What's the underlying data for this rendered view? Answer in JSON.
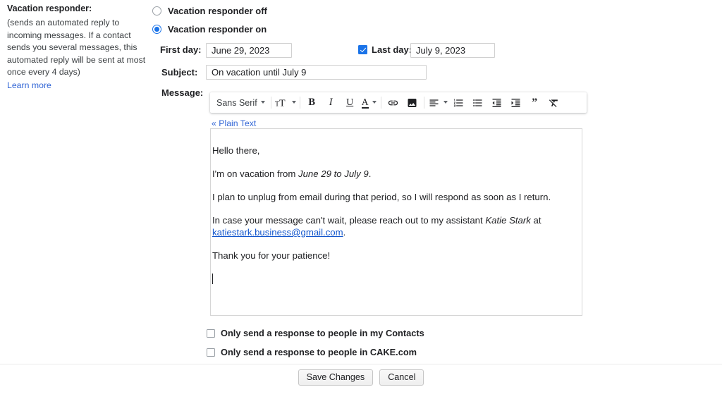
{
  "sidebar": {
    "title": "Vacation responder:",
    "description": "(sends an automated reply to incoming messages. If a contact sends you several messages, this automated reply will be sent at most once every 4 days)",
    "learn_more": "Learn more"
  },
  "responder": {
    "off_label": "Vacation responder off",
    "on_label": "Vacation responder on",
    "selected": "on"
  },
  "fields": {
    "first_day_label": "First day:",
    "first_day_value": "June 29, 2023",
    "last_day_label": "Last day:",
    "last_day_value": "July 9, 2023",
    "last_day_checked": true,
    "subject_label": "Subject:",
    "subject_value": "On vacation until July 9",
    "message_label": "Message:"
  },
  "toolbar": {
    "font_name": "Sans Serif",
    "items": [
      "font-family-selector",
      "text-size-icon",
      "bold-icon",
      "italic-icon",
      "underline-icon",
      "text-color-icon",
      "insert-link-icon",
      "insert-image-icon",
      "align-icon",
      "numbered-list-icon",
      "bulleted-list-icon",
      "indent-less-icon",
      "indent-more-icon",
      "quote-icon",
      "remove-formatting-icon"
    ]
  },
  "editor": {
    "plain_text_link": "« Plain Text",
    "paragraphs": [
      {
        "id": "greeting",
        "text": "Hello there,"
      },
      {
        "id": "dates",
        "prefix": "I'm on vacation from ",
        "italic": "June 29 to July 9",
        "suffix": "."
      },
      {
        "id": "unplug",
        "text": "I plan to unplug from email during that period, so I will respond as soon as I return."
      },
      {
        "id": "assistant",
        "prefix": "In case your message can't wait, please reach out to my assistant ",
        "italic": "Katie Stark",
        "mid": " at ",
        "link": "katiestark.business@gmail.com",
        "suffix": "."
      },
      {
        "id": "thanks",
        "text": "Thank you for your patience!"
      }
    ]
  },
  "options": [
    {
      "label": "Only send a response to people in my Contacts",
      "checked": false
    },
    {
      "label": "Only send a response to people in CAKE.com",
      "checked": false
    }
  ],
  "footer": {
    "save_label": "Save Changes",
    "cancel_label": "Cancel"
  },
  "colors": {
    "accent": "#1a73e8",
    "link": "#3367d6",
    "editor_link": "#1155cc",
    "text": "#202124"
  }
}
